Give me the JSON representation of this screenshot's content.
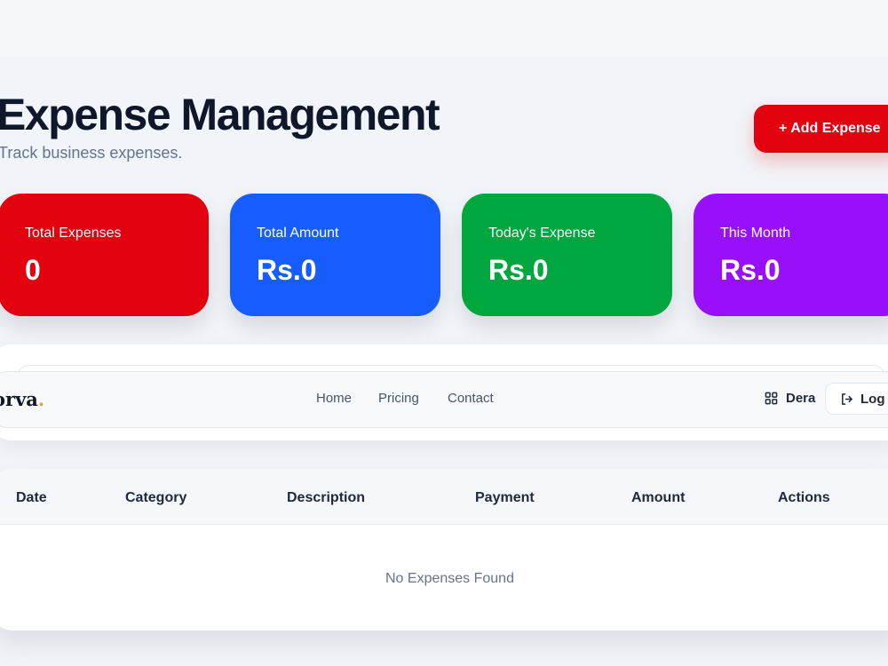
{
  "header": {
    "title": "Expense Management",
    "subtitle": "Track business expenses.",
    "add_button": "+ Add Expense"
  },
  "stats": [
    {
      "label": "Total Expenses",
      "value": "0",
      "color": "#e3000f"
    },
    {
      "label": "Total Amount",
      "value": "Rs.0",
      "color": "#175cff"
    },
    {
      "label": "Today's Expense",
      "value": "Rs.0",
      "color": "#00a63e"
    },
    {
      "label": "This Month",
      "value": "Rs.0",
      "color": "#9810fa"
    }
  ],
  "navbar": {
    "logo": "orva",
    "logo_dot": ".",
    "links": [
      "Home",
      "Pricing",
      "Contact"
    ],
    "user_label": "Dera",
    "logout_label": "Log o"
  },
  "table": {
    "columns": [
      "Date",
      "Category",
      "Description",
      "Payment",
      "Amount",
      "Actions"
    ],
    "empty_text": "No Expenses Found"
  },
  "icons": {
    "dashboard": "grid-icon",
    "logout": "logout-icon"
  }
}
